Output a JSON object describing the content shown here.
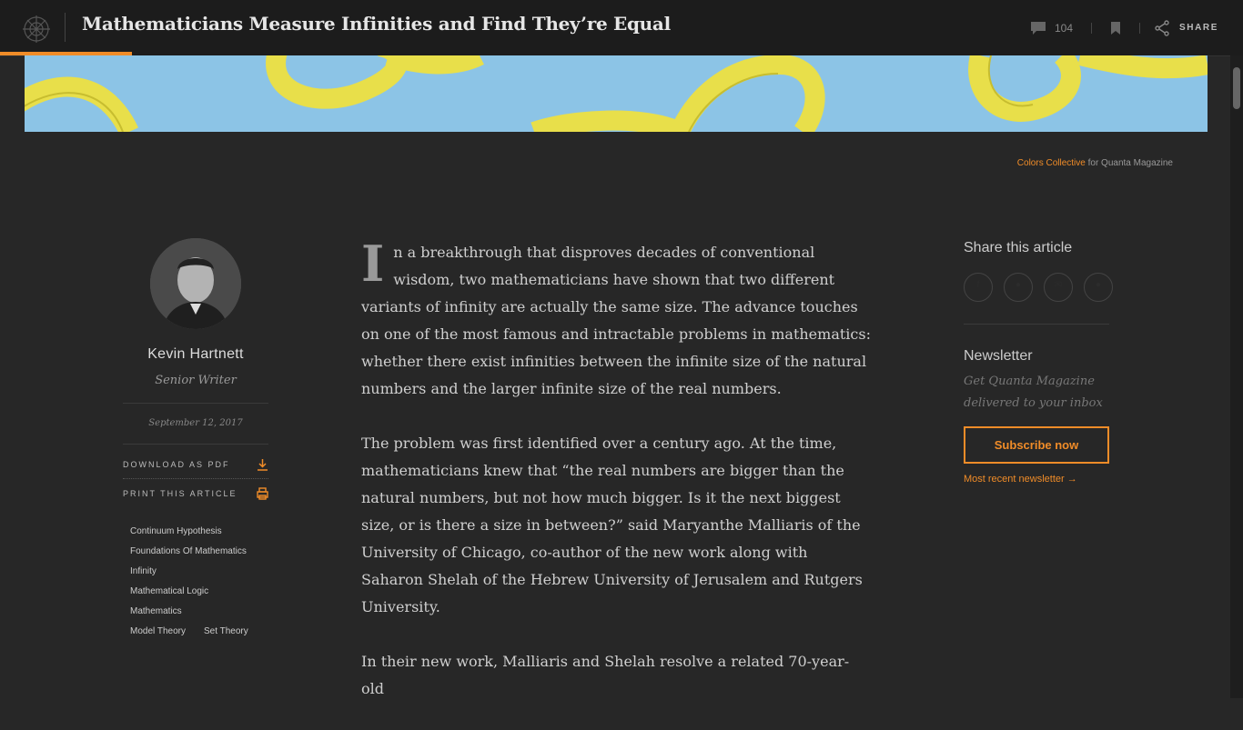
{
  "header": {
    "title": "Mathematicians Measure Infinities and Find They’re Equal",
    "comment_count": "104",
    "share_label": "SHARE",
    "reading_progress": 0.106
  },
  "hero": {
    "credit_name": "Colors Collective",
    "credit_suffix": "for Quanta Magazine"
  },
  "author": {
    "name": "Kevin Hartnett",
    "role": "Senior Writer",
    "date": "September 12, 2017"
  },
  "actions": {
    "download": "DOWNLOAD AS PDF",
    "print": "PRINT THIS ARTICLE"
  },
  "tags": [
    "Continuum Hypothesis",
    "Foundations Of Mathematics",
    "Infinity",
    "Mathematical Logic",
    "Mathematics",
    "Model Theory",
    "Set Theory"
  ],
  "article": {
    "dropcap": "I",
    "p1": "n a breakthrough that disproves decades of conventional wisdom, two mathematicians have shown that two different variants of infinity are actually the same size. The advance touches on one of the most famous and intractable problems in mathematics: whether there exist infinities between the infinite size of the natural numbers and the larger infinite size of the real numbers.",
    "p2": "The problem was first identified over a century ago. At the time, mathematicians knew that “the real numbers are bigger than the natural numbers, but not how much bigger. Is it the next biggest size, or is there a size in between?” said Maryanthe Malliaris of the University of Chicago, co-author of the new work along with Saharon Shelah of the Hebrew University of Jerusalem and Rutgers University.",
    "p3": "In their new work, Malliaris and Shelah resolve a related 70-year-old"
  },
  "sidebar_right": {
    "share_heading": "Share this article",
    "newsletter_heading": "Newsletter",
    "newsletter_desc": "Get Quanta Magazine delivered to your inbox",
    "subscribe_label": "Subscribe now",
    "recent_label": "Most recent newsletter →"
  },
  "colors": {
    "accent": "#f08c28",
    "background": "#272727",
    "header_bg": "#1c1c1c"
  }
}
